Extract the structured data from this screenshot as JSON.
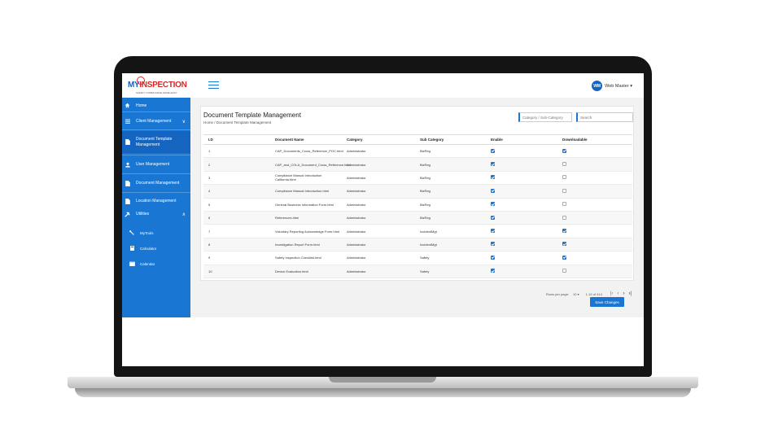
{
  "brand": {
    "logo_my": "MY",
    "logo_inspection": "INSPECTION",
    "tagline": "SAFETY COMPLIANCE MADE EASY"
  },
  "header": {
    "user_initials": "WM",
    "user_name": "Web Master ▾"
  },
  "sidebar": {
    "items": [
      {
        "label": "Home",
        "icon": "home-icon"
      },
      {
        "label": "Client Management",
        "icon": "list-icon",
        "chevron": "∨"
      },
      {
        "label": "Document Template Management",
        "icon": "document-icon"
      },
      {
        "label": "User Management",
        "icon": "user-icon"
      },
      {
        "label": "Document Management",
        "icon": "document-icon"
      },
      {
        "label": "Location Management",
        "icon": "document-icon"
      },
      {
        "label": "Utilities",
        "icon": "tools-icon",
        "chevron": "∧"
      }
    ],
    "subitems": [
      {
        "label": "MyTools",
        "icon": "wrench-icon"
      },
      {
        "label": "Calculator",
        "icon": "calculator-icon"
      },
      {
        "label": "Calendar",
        "icon": "calendar-icon"
      }
    ]
  },
  "main": {
    "title": "Document Template Management",
    "breadcrumb": "Home / Document Template Management",
    "category_filter_placeholder": "Category / Sub-Category",
    "search_placeholder": "Search",
    "table": {
      "headers": [
        "I.D",
        "Document Name",
        "Category",
        "Sub Category",
        "Enable",
        "Downloadable"
      ],
      "rows": [
        {
          "id": "1",
          "name": "CAP_Documents_Cross_Reference_POC.html",
          "category": "Administrator",
          "sub": "BizReg",
          "enable": true,
          "download": true
        },
        {
          "id": "2",
          "name": "CAP_and_COLA_Document_Cross_Reference.html",
          "category": "Administrator",
          "sub": "BizReg",
          "enable": true,
          "download": false
        },
        {
          "id": "3",
          "name": "Compliance Manual Introduction California.html",
          "category": "Administrator",
          "sub": "BizReg",
          "enable": true,
          "download": false
        },
        {
          "id": "4",
          "name": "Compliance Manual Introduction.html",
          "category": "Administrator",
          "sub": "BizReg",
          "enable": true,
          "download": false
        },
        {
          "id": "5",
          "name": "General Business Information Form.html",
          "category": "Administrator",
          "sub": "BizReg",
          "enable": true,
          "download": false
        },
        {
          "id": "6",
          "name": "References.html",
          "category": "Administrator",
          "sub": "BizReg",
          "enable": true,
          "download": false
        },
        {
          "id": "7",
          "name": "Voluntary Reporting Acknowledge Form.html",
          "category": "Administrator",
          "sub": "IncidentMgt",
          "enable": true,
          "download": true
        },
        {
          "id": "8",
          "name": "Investigation Report Form.html",
          "category": "Administrator",
          "sub": "IncidentMgt",
          "enable": true,
          "download": true
        },
        {
          "id": "9",
          "name": "Safety Inspection Checklist.html",
          "category": "Administrator",
          "sub": "Safety",
          "enable": true,
          "download": true
        },
        {
          "id": "10",
          "name": "Device Evaluation.html",
          "category": "Administrator",
          "sub": "Safety",
          "enable": true,
          "download": false
        }
      ]
    },
    "pagination": {
      "rows_per_page_label": "Rows per page:",
      "rows_per_page": "10 ▾",
      "range": "1-10 of 414"
    },
    "save_label": "Save Changes"
  },
  "colors": {
    "accent": "#1976d2",
    "sidebar": "#1976d2",
    "logo_red": "#d62828"
  }
}
